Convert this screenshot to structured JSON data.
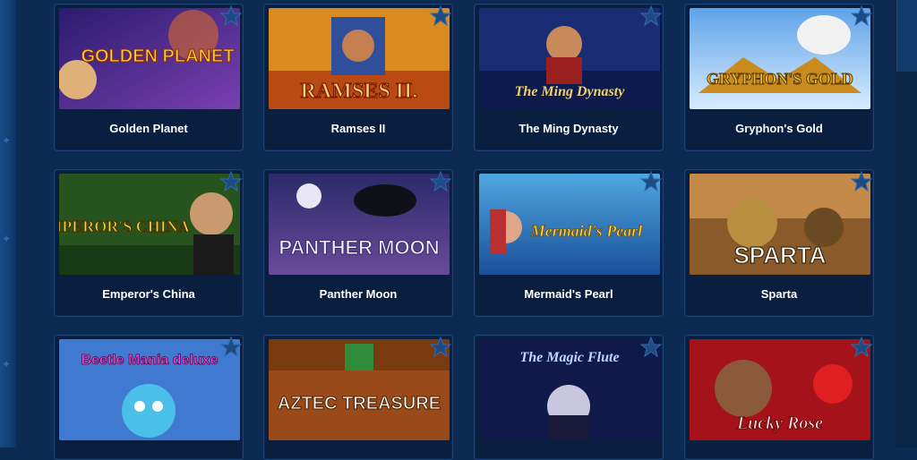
{
  "games": [
    {
      "title": "Golden Planet",
      "art": "GOLDEN PLANET"
    },
    {
      "title": "Ramses II",
      "art": "RAMSES II."
    },
    {
      "title": "The Ming Dynasty",
      "art": "The Ming Dynasty"
    },
    {
      "title": "Gryphon's Gold",
      "art": "GRYPHON'S GOLD"
    },
    {
      "title": "Emperor's China",
      "art": "EMPEROR'S CHINA"
    },
    {
      "title": "Panther Moon",
      "art": "PANTHER MOON"
    },
    {
      "title": "Mermaid's Pearl",
      "art": "Mermaid's Pearl"
    },
    {
      "title": "Sparta",
      "art": "SPARTA"
    },
    {
      "title": "Beetle Mania deluxe",
      "art": "Beetle Mania deluxe"
    },
    {
      "title": "Aztec Treasure",
      "art": "AZTEC TREASURE"
    },
    {
      "title": "The Magic Flute",
      "art": "The Magic Flute"
    },
    {
      "title": "Lucky Rose",
      "art": "Lucky Rose"
    }
  ],
  "favorite_icon": "star-icon",
  "colors": {
    "background": "#0d2a52",
    "card": "#0a1f3f",
    "card_border": "#1d4476"
  }
}
